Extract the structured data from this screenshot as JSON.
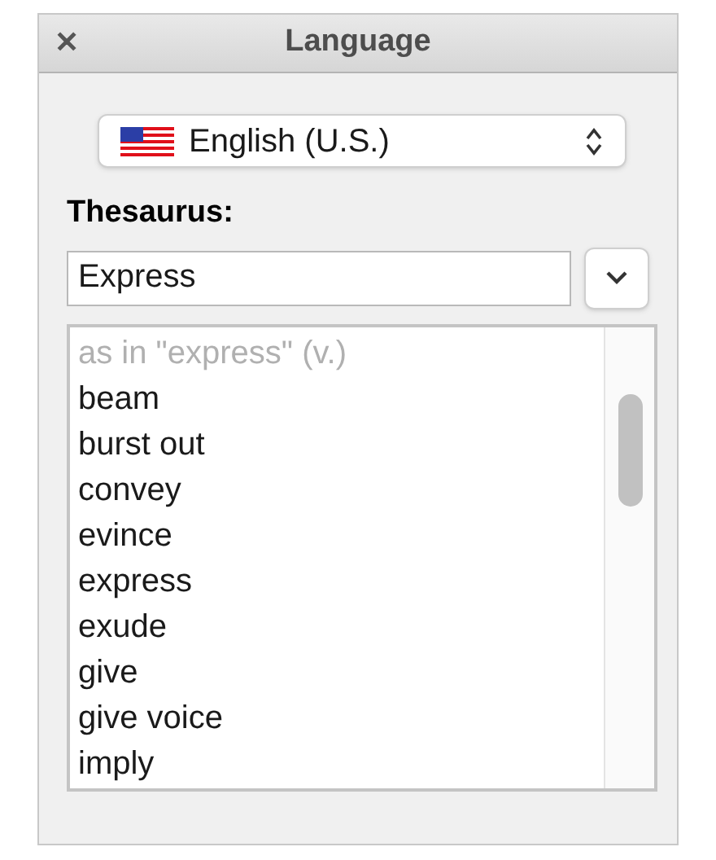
{
  "window": {
    "title": "Language",
    "close": "✕"
  },
  "language_popup": {
    "value": "English (U.S.)"
  },
  "thesaurus": {
    "label": "Thesaurus:",
    "value": "Express"
  },
  "results": [
    {
      "kind": "header",
      "text": "as in \"express\" (v.)"
    },
    {
      "kind": "word",
      "text": "beam"
    },
    {
      "kind": "word",
      "text": "burst out"
    },
    {
      "kind": "word",
      "text": "convey"
    },
    {
      "kind": "word",
      "text": "evince"
    },
    {
      "kind": "word",
      "text": "express"
    },
    {
      "kind": "word",
      "text": "exude"
    },
    {
      "kind": "word",
      "text": "give"
    },
    {
      "kind": "word",
      "text": "give voice"
    },
    {
      "kind": "word",
      "text": "imply"
    }
  ]
}
